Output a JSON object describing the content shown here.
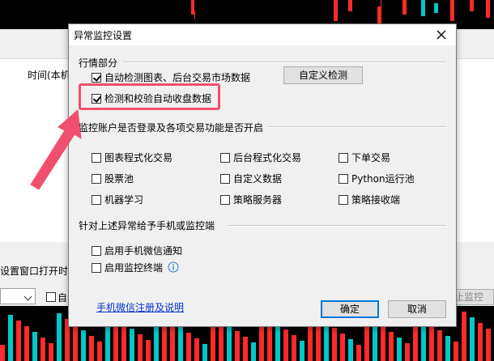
{
  "background": {
    "label_time": "时间(本机",
    "label_settings": "设置窗口打开时",
    "label_auto": "自动",
    "label_stop": "止监控"
  },
  "dialog": {
    "title": "异常监控设置",
    "section_market": {
      "label": "行情部分",
      "auto_detect_label": "自动检测图表、后台交易市场数据",
      "auto_detect_checked": true,
      "verify_close_label": "检测和校验自动收盘数据",
      "verify_close_checked": true,
      "custom_detect_button": "自定义检测"
    },
    "section_account": {
      "label": "监控账户是否登录及各项交易功能是否开启",
      "options": [
        {
          "label": "图表程式化交易",
          "checked": false
        },
        {
          "label": "后台程式化交易",
          "checked": false
        },
        {
          "label": "下单交易",
          "checked": false
        },
        {
          "label": "股票池",
          "checked": false
        },
        {
          "label": "自定义数据",
          "checked": false
        },
        {
          "label": "Python运行池",
          "checked": false
        },
        {
          "label": "机器学习",
          "checked": false
        },
        {
          "label": "策略服务器",
          "checked": false
        },
        {
          "label": "策略接收端",
          "checked": false
        }
      ]
    },
    "section_notify": {
      "label": "针对上述异常给予手机或监控端",
      "wechat_label": "启用手机微信通知",
      "wechat_checked": false,
      "terminal_label": "启用监控终端",
      "terminal_checked": false
    },
    "help_link": "手机微信注册及说明",
    "ok_button": "确定",
    "cancel_button": "取消"
  },
  "colors": {
    "highlight": "#f0506e",
    "link": "#0033cc",
    "candle_up": "#ff2a2a",
    "candle_down": "#00c8c8"
  },
  "icons": {
    "close": "close-icon",
    "info": "info-icon",
    "arrow": "annotation-arrow"
  }
}
